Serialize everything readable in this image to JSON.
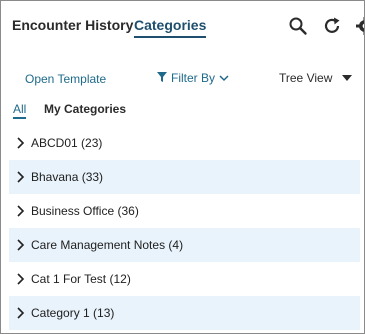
{
  "header": {
    "tab_encounter_history": "Encounter History",
    "tab_categories": "Categories",
    "icons": [
      "search-icon",
      "refresh-icon",
      "gear-icon"
    ]
  },
  "toolbar": {
    "open_template": "Open Template",
    "filter_by": "Filter By",
    "tree_view": "Tree View"
  },
  "subtabs": {
    "all": "All",
    "my_categories": "My Categories"
  },
  "categories": [
    {
      "label": "ABCD01 (23)"
    },
    {
      "label": "Bhavana (33)"
    },
    {
      "label": "Business Office (36)"
    },
    {
      "label": "Care Management Notes (4)"
    },
    {
      "label": "Cat 1 For Test (12)"
    },
    {
      "label": "Category 1 (13)"
    }
  ],
  "colors": {
    "accent": "#1f6a8a",
    "row_alt_bg": "#e9f3fb"
  }
}
